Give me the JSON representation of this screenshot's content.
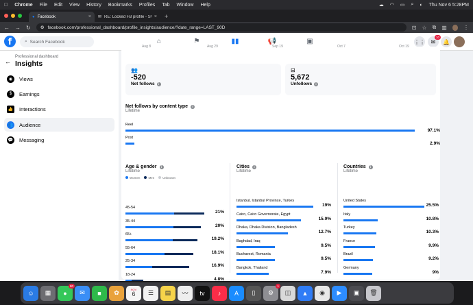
{
  "menubar": {
    "app": "Chrome",
    "items": [
      "File",
      "Edit",
      "View",
      "History",
      "Bookmarks",
      "Profiles",
      "Tab",
      "Window",
      "Help"
    ],
    "datetime": "Thu Nov 6  5:28PM"
  },
  "tabs": [
    {
      "title": "Facebook",
      "active": true
    },
    {
      "title": "RE: Locked FB profile - SWA",
      "active": false
    }
  ],
  "address": {
    "url": "facebook.com/professional_dashboard/profile_insights/audience/?date_range=LAST_90D"
  },
  "fb": {
    "search_placeholder": "Search Facebook",
    "notif_badge": "10",
    "sidebar": {
      "subtitle": "Professional dashboard",
      "title": "Insights",
      "items": [
        {
          "label": "Views",
          "active": false
        },
        {
          "label": "Earnings",
          "active": false
        },
        {
          "label": "Interactions",
          "active": false
        },
        {
          "label": "Audience",
          "active": true
        },
        {
          "label": "Messaging",
          "active": false
        }
      ]
    },
    "axis_ticks": [
      "Aug 8",
      "Aug 29",
      "Sep 19",
      "Oct 7",
      "Oct 19"
    ],
    "stats": [
      {
        "value": "-520",
        "label": "Net follows"
      },
      {
        "value": "5,672",
        "label": "Unfollows"
      }
    ],
    "content_type": {
      "title": "Net follows by content type",
      "subtitle": "Lifetime",
      "rows": [
        {
          "label": "Reel",
          "pct": 97.1,
          "text": "97.1%"
        },
        {
          "label": "Post",
          "pct": 2.9,
          "text": "2.9%"
        }
      ]
    },
    "age_gender": {
      "title": "Age & gender",
      "subtitle": "Lifetime",
      "legend": [
        "Women",
        "Men",
        "Unknown"
      ],
      "rows": [
        {
          "label": "45-54",
          "women": 0.62,
          "men": 0.38,
          "total": 21,
          "text": "21%"
        },
        {
          "label": "35-44",
          "women": 0.64,
          "men": 0.36,
          "total": 20,
          "text": "20%"
        },
        {
          "label": "65+",
          "women": 0.66,
          "men": 0.34,
          "total": 19.2,
          "text": "19.2%"
        },
        {
          "label": "55-64",
          "women": 0.58,
          "men": 0.42,
          "total": 18.1,
          "text": "18.1%"
        },
        {
          "label": "25-34",
          "women": 0.42,
          "men": 0.58,
          "total": 16.9,
          "text": "16.9%"
        },
        {
          "label": "18-24",
          "women": 0.35,
          "men": 0.65,
          "total": 4.8,
          "text": "4.8%"
        }
      ]
    },
    "cities": {
      "title": "Cities",
      "subtitle": "Lifetime",
      "rows": [
        {
          "label": "Istanbul, Istanbul Province, Turkey",
          "pct": 19,
          "text": "19%"
        },
        {
          "label": "Cairo, Cairo Governorate, Egypt",
          "pct": 15.9,
          "text": "15.9%"
        },
        {
          "label": "Dhaka, Dhaka Division, Bangladesh",
          "pct": 12.7,
          "text": "12.7%"
        },
        {
          "label": "Baghdad, Iraq",
          "pct": 9.5,
          "text": "9.5%"
        },
        {
          "label": "Bucharest, Romania",
          "pct": 9.5,
          "text": "9.5%"
        },
        {
          "label": "Bangkok, Thailand",
          "pct": 7.9,
          "text": "7.9%"
        }
      ]
    },
    "countries": {
      "title": "Countries",
      "subtitle": "Lifetime",
      "rows": [
        {
          "label": "United States",
          "pct": 25.5,
          "text": "25.5%"
        },
        {
          "label": "Italy",
          "pct": 10.8,
          "text": "10.8%"
        },
        {
          "label": "Turkey",
          "pct": 10.3,
          "text": "10.3%"
        },
        {
          "label": "France",
          "pct": 9.9,
          "text": "9.9%"
        },
        {
          "label": "Brazil",
          "pct": 9.2,
          "text": "9.2%"
        },
        {
          "label": "Germany",
          "pct": 9,
          "text": "9%"
        }
      ]
    }
  },
  "colors": {
    "fb_blue": "#1877f2",
    "men_dark": "#0b2a5b"
  },
  "dock": {
    "apps": [
      {
        "name": "finder",
        "color": "#2a7be4",
        "glyph": "☺"
      },
      {
        "name": "launchpad",
        "color": "#6d6d72",
        "glyph": "▦"
      },
      {
        "name": "messages",
        "color": "#34c759",
        "glyph": "●",
        "badge": "80"
      },
      {
        "name": "mail",
        "color": "#3a8ef6",
        "glyph": "✉"
      },
      {
        "name": "facetime",
        "color": "#2fb94a",
        "glyph": "■"
      },
      {
        "name": "photos",
        "color": "#e9a23b",
        "glyph": "✿"
      },
      {
        "name": "calendar",
        "color": "#f5f5f5",
        "glyph": "6",
        "sub": "NOV"
      },
      {
        "name": "reminders",
        "color": "#f2f2f2",
        "glyph": "☰"
      },
      {
        "name": "notes",
        "color": "#f7d44a",
        "glyph": "▤"
      },
      {
        "name": "freeform",
        "color": "#eeeeee",
        "glyph": "〰"
      },
      {
        "name": "apple-tv",
        "color": "#111111",
        "glyph": "tv"
      },
      {
        "name": "music",
        "color": "#fa2d48",
        "glyph": "♪"
      },
      {
        "name": "app-store",
        "color": "#1a8cff",
        "glyph": "A"
      },
      {
        "name": "iphone-mirroring",
        "color": "#555555",
        "glyph": "▯"
      },
      {
        "name": "system-settings",
        "color": "#8e8e93",
        "glyph": "⚙",
        "badge": "1"
      },
      {
        "name": "preview",
        "color": "#d9d9d9",
        "glyph": "◫"
      },
      {
        "name": "keynote",
        "color": "#2f7cf6",
        "glyph": "▲"
      },
      {
        "name": "chrome",
        "color": "#e8e8e8",
        "glyph": "◉"
      },
      {
        "name": "zoom",
        "color": "#2d8cff",
        "glyph": "▶"
      },
      {
        "name": "window",
        "color": "#4b4b50",
        "glyph": "▣"
      },
      {
        "name": "trash",
        "color": "#c7c7cc",
        "glyph": "🗑"
      }
    ]
  }
}
